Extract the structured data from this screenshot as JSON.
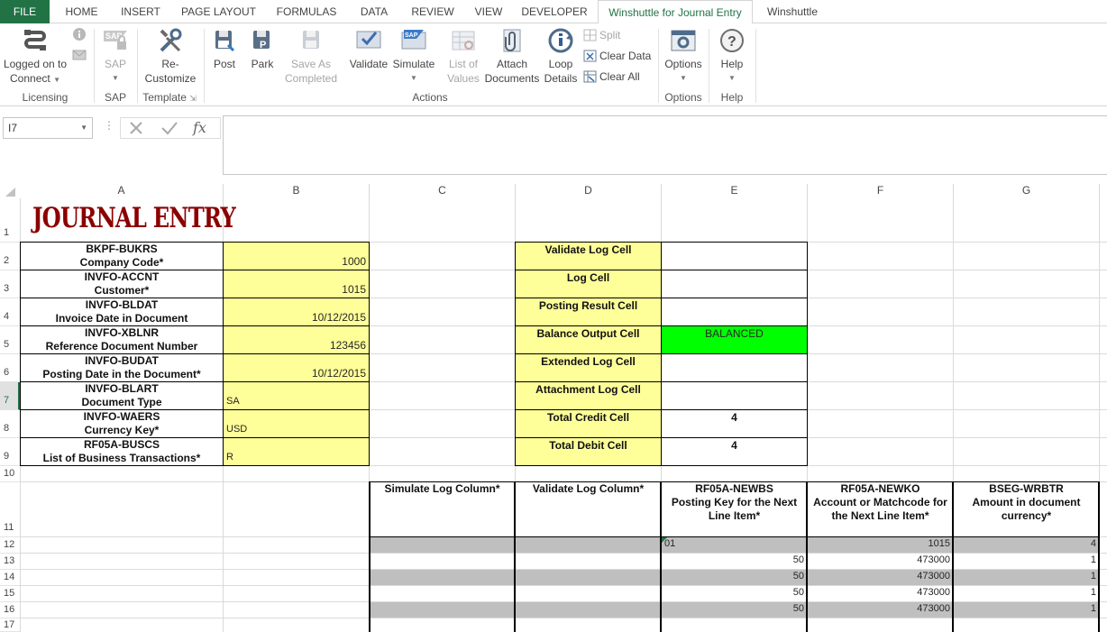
{
  "tabs": [
    "FILE",
    "HOME",
    "INSERT",
    "PAGE LAYOUT",
    "FORMULAS",
    "DATA",
    "REVIEW",
    "VIEW",
    "DEVELOPER",
    "Winshuttle for Journal Entry",
    "Winshuttle"
  ],
  "ribbon": {
    "logged_on": "Logged on to",
    "connect": "Connect",
    "sap": "SAP",
    "recustomize1": "Re-",
    "recustomize2": "Customize",
    "post": "Post",
    "park": "Park",
    "save_as1": "Save As",
    "save_as2": "Completed",
    "validate": "Validate",
    "simulate": "Simulate",
    "list_of1": "List of",
    "list_of2": "Values",
    "attach1": "Attach",
    "attach2": "Documents",
    "loop1": "Loop",
    "loop2": "Details",
    "split": "Split",
    "clear_data": "Clear Data",
    "clear_all": "Clear All",
    "options": "Options",
    "help": "Help",
    "groups": {
      "licensing": "Licensing",
      "sap": "SAP",
      "template": "Template",
      "actions": "Actions",
      "options": "Options",
      "help": "Help"
    }
  },
  "formula_bar": {
    "name_box": "I7",
    "formula": ""
  },
  "columns": [
    "A",
    "B",
    "C",
    "D",
    "E",
    "F",
    "G"
  ],
  "rows": [
    "1",
    "2",
    "3",
    "4",
    "5",
    "6",
    "7",
    "8",
    "9",
    "10",
    "11",
    "12",
    "13",
    "14",
    "15",
    "16",
    "17"
  ],
  "title": "JOURNAL ENTRY",
  "header_fields": [
    {
      "code": "BKPF-BUKRS",
      "label": "Company Code*",
      "value": "1000",
      "align": "num"
    },
    {
      "code": "INVFO-ACCNT",
      "label": "Customer*",
      "value": "1015",
      "align": "num"
    },
    {
      "code": "INVFO-BLDAT",
      "label": "Invoice Date in Document",
      "value": "10/12/2015",
      "align": "num"
    },
    {
      "code": "INVFO-XBLNR",
      "label": "Reference Document Number",
      "value": "123456",
      "align": "num"
    },
    {
      "code": "INVFO-BUDAT",
      "label": "Posting Date in the Document*",
      "value": "10/12/2015",
      "align": "num"
    },
    {
      "code": "INVFO-BLART",
      "label": "Document Type",
      "value": "SA",
      "align": "left"
    },
    {
      "code": "INVFO-WAERS",
      "label": "Currency Key*",
      "value": "USD",
      "align": "left"
    },
    {
      "code": "RF05A-BUSCS",
      "label": "List of Business Transactions*",
      "value": "R",
      "align": "left"
    }
  ],
  "log_cells": [
    {
      "label": "Validate Log Cell",
      "value": ""
    },
    {
      "label": "Log Cell",
      "value": ""
    },
    {
      "label": "Posting Result Cell",
      "value": ""
    },
    {
      "label": "Balance Output Cell",
      "value": "BALANCED"
    },
    {
      "label": "Extended Log Cell",
      "value": ""
    },
    {
      "label": "Attachment Log Cell",
      "value": ""
    },
    {
      "label": "Total Credit Cell",
      "value": "4"
    },
    {
      "label": "Total Debit Cell",
      "value": "4"
    }
  ],
  "line_headers": {
    "c": "Simulate Log Column*",
    "d": "Validate Log Column*",
    "e1": "RF05A-NEWBS",
    "e2": "Posting Key for the Next",
    "e3": "Line Item*",
    "f1": "RF05A-NEWKO",
    "f2": "Account or Matchcode for",
    "f3": "the Next Line Item*",
    "g1": "BSEG-WRBTR",
    "g2": "Amount in document",
    "g3": "currency*"
  },
  "line_items": [
    {
      "posting_key": "01",
      "account": "1015",
      "amount": "4"
    },
    {
      "posting_key": "50",
      "account": "473000",
      "amount": "1"
    },
    {
      "posting_key": "50",
      "account": "473000",
      "amount": "1"
    },
    {
      "posting_key": "50",
      "account": "473000",
      "amount": "1"
    },
    {
      "posting_key": "50",
      "account": "473000",
      "amount": "1"
    }
  ],
  "colors": {
    "excel_green": "#217346",
    "yellow": "#ffff99",
    "balanced_green": "#00ff00",
    "title_red": "#8b0000",
    "row_gray": "#bfbfbf"
  }
}
